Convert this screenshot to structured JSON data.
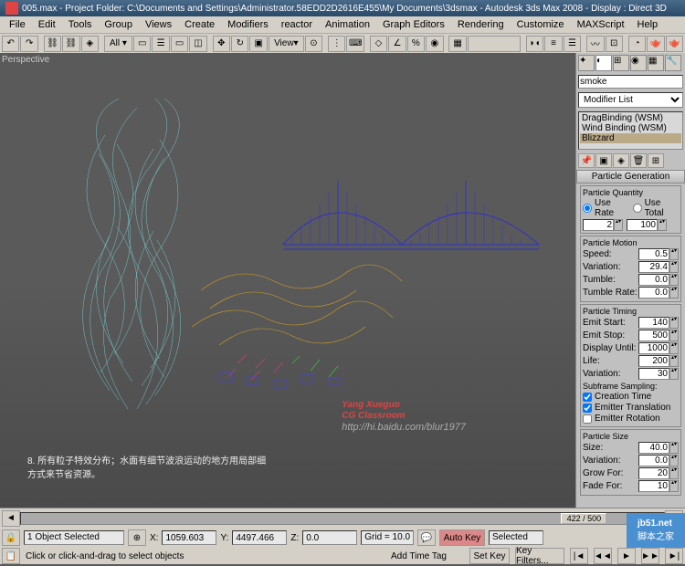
{
  "title": "005.max - Project Folder: C:\\Documents and Settings\\Administrator.58EDD2D2616E455\\My Documents\\3dsmax - Autodesk 3ds Max 2008 - Display : Direct 3D",
  "menus": [
    "File",
    "Edit",
    "Tools",
    "Group",
    "Views",
    "Create",
    "Modifiers",
    "reactor",
    "Animation",
    "Graph Editors",
    "Rendering",
    "Customize",
    "MAXScript",
    "Help"
  ],
  "viewport_label": "Perspective",
  "modifier": {
    "name": "smoke",
    "list_label": "Modifier List",
    "stack": [
      "DragBinding (WSM)",
      "Wind Binding (WSM)",
      "Blizzard"
    ]
  },
  "rollouts": {
    "pg_title": "Particle Generation",
    "quantity_title": "Particle Quantity",
    "use_rate": "Use Rate",
    "use_total": "Use Total",
    "rate_val": "2",
    "total_val": "100",
    "motion_title": "Particle Motion",
    "speed": {
      "label": "Speed:",
      "val": "0.5"
    },
    "variation1": {
      "label": "Variation:",
      "val": "29.4"
    },
    "tumble": {
      "label": "Tumble:",
      "val": "0.0"
    },
    "tumble_rate": {
      "label": "Tumble Rate:",
      "val": "0.0"
    },
    "timing_title": "Particle Timing",
    "emit_start": {
      "label": "Emit Start:",
      "val": "140"
    },
    "emit_stop": {
      "label": "Emit Stop:",
      "val": "500"
    },
    "display_until": {
      "label": "Display Until:",
      "val": "1000"
    },
    "life": {
      "label": "Life:",
      "val": "200"
    },
    "variation2": {
      "label": "Variation:",
      "val": "30"
    },
    "subframe": "Subframe Sampling:",
    "creation_time": "Creation Time",
    "emitter_trans": "Emitter Translation",
    "emitter_rot": "Emitter Rotation",
    "size_title": "Particle Size",
    "size": {
      "label": "Size:",
      "val": "40.0"
    },
    "variation3": {
      "label": "Variation:",
      "val": "0.0"
    },
    "grow_for": {
      "label": "Grow For:",
      "val": "20"
    },
    "fade_for": {
      "label": "Fade For:",
      "val": "10"
    }
  },
  "timeline": {
    "frame": "422 / 500"
  },
  "status": {
    "selection": "1 Object Selected",
    "x": "1059.603",
    "y": "4497.466",
    "z": "0.0",
    "grid": "Grid = 10.0",
    "autokey": "Auto Key",
    "selected": "Selected",
    "hint": "Click or click-and-drag to select objects",
    "addtag": "Add Time Tag",
    "setkey": "Set Key",
    "keyfilters": "Key Filters..."
  },
  "watermark": {
    "l1": "Yang Xueguo",
    "l2": "CG Classroom",
    "l3": "http://hi.baidu.com/blur1977"
  },
  "annotation": {
    "l1": "8. 所有粒子特效分布；水面有细节波浪运动的地方用局部细",
    "l2": "方式来节省资源。"
  },
  "logo": {
    "l1": "jb51.net",
    "l2": "脚本之家"
  }
}
